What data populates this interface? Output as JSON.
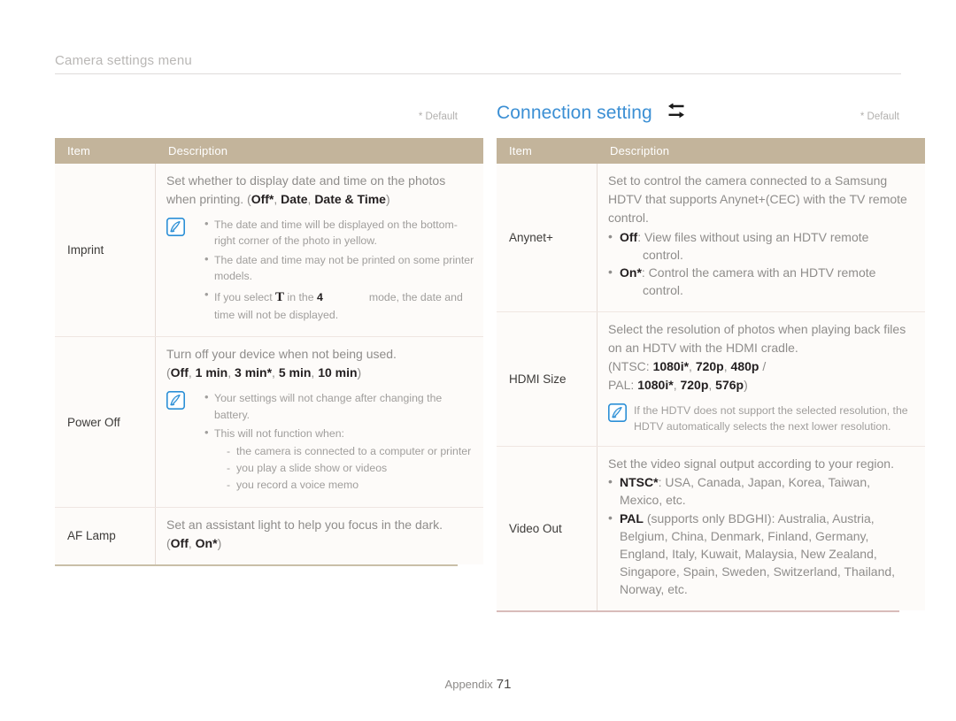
{
  "page": {
    "header_title": "Camera settings menu",
    "footer_label": "Appendix",
    "footer_page": "71",
    "default_note": "* Default",
    "accent_color": "#3b8fd4",
    "table_header_color": "#c3b49b"
  },
  "left": {
    "default_note": "* Default",
    "columns": {
      "item": "Item",
      "description": "Description"
    },
    "rows": [
      {
        "item": "Imprint",
        "lead_1": "Set whether to display date and time on the photos",
        "lead_2_pre": "when printing. (",
        "lead_2_b1": "Off*",
        "lead_2_sep1": ", ",
        "lead_2_b2": "Date",
        "lead_2_sep2": ", ",
        "lead_2_b3": "Date & Time",
        "lead_2_post": ")",
        "note_icon": "pen-note-icon",
        "notes": [
          "The date and time will be displayed on the bottom-right corner of the photo in yellow.",
          "The date and time may not be printed on some printer models."
        ],
        "note3_pre": "If you select ",
        "note3_glyph": "T",
        "note3_mid": " in the ",
        "note3_mode": "4",
        "note3_post": "mode, the date and time will not be displayed."
      },
      {
        "item": "Power Off",
        "lead_1": "Turn off your device when not being used.",
        "lead_2_pre": "(",
        "lead_2_b1": "Off",
        "lead_2_sep1": ", ",
        "lead_2_b2": "1 min",
        "lead_2_sep2": ", ",
        "lead_2_b3": "3 min*",
        "lead_2_sep3": ", ",
        "lead_2_b4": "5 min",
        "lead_2_sep4": ", ",
        "lead_2_b5": "10 min",
        "lead_2_post": ")",
        "note_icon": "pen-note-icon",
        "notes": [
          "Your settings will not change after changing the battery.",
          "This will not function when:"
        ],
        "sub_items": [
          "the camera is connected to a computer or printer",
          "you play a slide show or videos",
          "you record a voice memo"
        ]
      },
      {
        "item": "AF Lamp",
        "lead_1": "Set an assistant light to help you focus in the dark.",
        "lead_2_pre": "(",
        "lead_2_b1": "Off",
        "lead_2_sep1": ", ",
        "lead_2_b2": "On*",
        "lead_2_post": ")"
      }
    ]
  },
  "right": {
    "section_title": "Connection setting",
    "section_icon": "bidirectional-arrows-icon",
    "default_note": "* Default",
    "columns": {
      "item": "Item",
      "description": "Description"
    },
    "rows": [
      {
        "item": "Anynet+",
        "lead_1": "Set to control the camera connected to a Samsung",
        "lead_2": "HDTV that supports Anynet+(CEC) with the TV remote",
        "lead_3": "control.",
        "b1_label": "Off",
        "b1_text": ": View files without using an HDTV remote",
        "b1_hang": "control.",
        "b2_label": "On*",
        "b2_text": ": Control the camera with an HDTV remote",
        "b2_hang": "control."
      },
      {
        "item": "HDMI Size",
        "lead_1": "Select the resolution of photos when playing back files",
        "lead_2": "on an HDTV with the HDMI cradle.",
        "ntsc_pre": "(NTSC: ",
        "ntsc_b1": "1080i*",
        "ntsc_s1": ", ",
        "ntsc_b2": "720p",
        "ntsc_s2": ", ",
        "ntsc_b3": "480p",
        "ntsc_post": " /",
        "pal_pre": "PAL: ",
        "pal_b1": "1080i*",
        "pal_s1": ", ",
        "pal_b2": "720p",
        "pal_s2": ", ",
        "pal_b3": "576p",
        "pal_post": ")",
        "note_icon": "pen-note-icon",
        "note_text": "If the HDTV does not support the selected resolution, the HDTV automatically selects the next lower resolution."
      },
      {
        "item": "Video Out",
        "lead_1": "Set the video signal output according to your region.",
        "b1_label": "NTSC*",
        "b1_text": ": USA, Canada, Japan, Korea, Taiwan, Mexico, etc.",
        "b2_label": "PAL",
        "b2_text": " (supports only BDGHI): Australia, Austria, Belgium, China, Denmark, Finland, Germany, England, Italy, Kuwait, Malaysia, New Zealand, Singapore, Spain, Sweden, Switzerland, Thailand, Norway, etc."
      }
    ]
  }
}
